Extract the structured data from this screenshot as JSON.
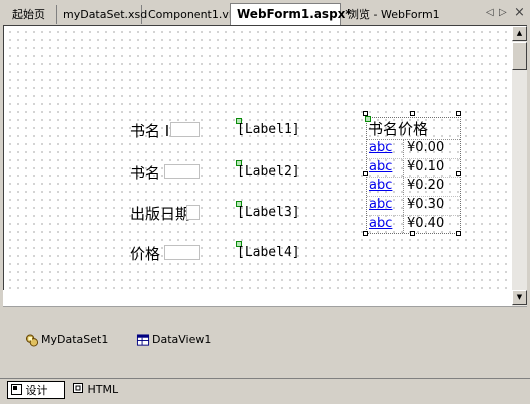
{
  "tabs": [
    {
      "label": "起始页",
      "active": false
    },
    {
      "label": "myDataSet.xsd",
      "active": false
    },
    {
      "label": "Component1.vb",
      "active": false
    },
    {
      "label": "WebForm1.aspx*",
      "active": true
    },
    {
      "label": "浏览 - WebForm1",
      "active": false
    }
  ],
  "nav": {
    "prev": "◁",
    "next": "▷",
    "close": "×"
  },
  "form": {
    "labels": [
      "书名 ID",
      "书名",
      "出版日期",
      "价格"
    ],
    "server_labels": [
      "[Label1]",
      "[Label2]",
      "[Label3]",
      "[Label4]"
    ]
  },
  "grid": {
    "header": "书名价格",
    "rows": [
      {
        "link": "abc",
        "price": "¥0.00"
      },
      {
        "link": "abc",
        "price": "¥0.10"
      },
      {
        "link": "abc",
        "price": "¥0.20"
      },
      {
        "link": "abc",
        "price": "¥0.30"
      },
      {
        "link": "abc",
        "price": "¥0.40"
      }
    ]
  },
  "components": [
    {
      "label": "MyDataSet1",
      "icon": "dataset-icon"
    },
    {
      "label": "DataView1",
      "icon": "dataview-icon"
    }
  ],
  "view_tabs": [
    {
      "label": "设计",
      "selected": true,
      "icon": "design-view-icon"
    },
    {
      "label": "HTML",
      "selected": false,
      "icon": "html-view-icon"
    }
  ],
  "colors": {
    "link": "#0000ee",
    "glyph": "#0a8a0a",
    "tray_bg": "#d4d0c8"
  }
}
